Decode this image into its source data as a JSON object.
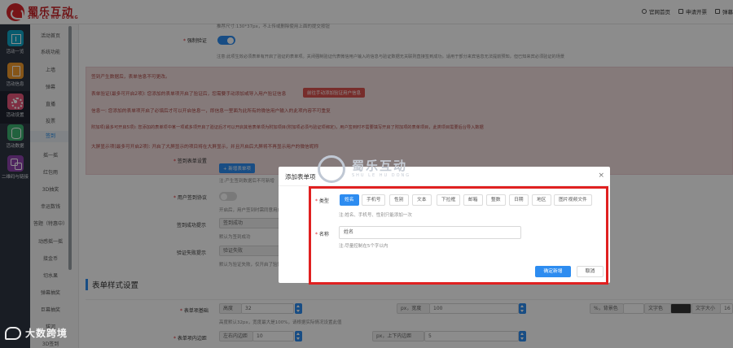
{
  "header": {
    "logo_cn": "蜀乐互动",
    "logo_en": "SHU LE HU DONG",
    "links": [
      "官网首页",
      "申请开票",
      "弹幕"
    ]
  },
  "sidebar": {
    "items": [
      {
        "label": "活动一览",
        "icon": "grid-icon",
        "color": "#0fa7c8"
      },
      {
        "label": "活动信息",
        "icon": "document-icon",
        "color": "#f29b2c"
      },
      {
        "label": "活动设置",
        "icon": "gear-icon",
        "color": "#e8577a"
      },
      {
        "label": "活动数据",
        "icon": "database-icon",
        "color": "#3cb371"
      },
      {
        "label": "二维码与链接",
        "icon": "link-icon",
        "color": "#8e44ad"
      }
    ]
  },
  "submenu": {
    "items": [
      "活动首页",
      "系统功能",
      "上墙",
      "弹幕",
      "直播",
      "投票",
      "签到",
      "摇一摇",
      "红包雨",
      "3D抽奖",
      "幸运数钱",
      "答题（特惠中）",
      "动感摇一摇",
      "接金币",
      "切水果",
      "弹幕抽奖",
      "巨幕抽奖",
      "拔河",
      "3D签到"
    ],
    "active_index": 6
  },
  "main": {
    "top_hint": "推荐尺寸:130*37px，不上传或删除使用上面的提交按钮",
    "force_verify": {
      "label": "强制验证",
      "hint": "注意:此项生效必须表单有开启了验证的表单项。关闭强制验证代表微信用户输入的信息与验证数据无关联则直接签到成功，适用于部分来宾信息无法提前预知，但已知来宾必须验证的场景",
      "on": true
    },
    "notice": {
      "lines": [
        "签到产生数据后，表单信息不可更改。",
        "表单验证(最多可开启2项): 您添加的表单项开启了验证后，您需要手动添加或导入用户验证信息",
        "信息一: 您添加的表单项开启了必填后才可以开启信息一，即信息一里面为此所有的微信用户输入的此项内容不可重复",
        "附加项(最多可开启5项): 您添加的表单项中某一项或多项开启了验证后才可以开启其他表单项为附加项目(附加项必须与验证项绑定)，用户签到时不需要填写开启了附加项的表单项目，此类项目需要后台导入数据",
        "大屏显示项(最多可开启2项): 开启了大屏显示的项目将在大屏显示，并且开启后大屏将不再显示用户的微信昵称"
      ],
      "button": "前往手动添加验证用户信息"
    },
    "signin_form": {
      "label": "签到表单设置",
      "button": "+ 新增表单项",
      "hint": "注:产生签到数据后不可新增"
    },
    "user_protocol": {
      "label": "用户签到协议",
      "hint": "开启后，用户签到时需同意用户协议后才可签到",
      "on": false
    },
    "success_tip": {
      "label": "签到成功提示",
      "value": "签到成功",
      "hint": "默认为签到成功"
    },
    "fail_tip": {
      "label": "验证失败提示",
      "value": "验证失败",
      "hint": "默认为验证失败，仅开启了验证功能时有效"
    },
    "style_section": {
      "title": "表单样式设置",
      "base": {
        "label": "表单项基础",
        "height_prefix": "高度",
        "height_value": "32",
        "height_hint": "高度默认32px，宽度最大是100%，请根据实际情况设置此值",
        "width_prefix": "px，宽度",
        "width_value": "100",
        "bg_prefix": "%，背景色",
        "color_prefix": "文字色",
        "fontsize_prefix": "文字大小",
        "fontsize_value": "16"
      },
      "padding": {
        "label": "表单项内边距",
        "lr_prefix": "左右内边距",
        "lr_value": "10",
        "tb_prefix": "px，上下内边距",
        "tb_value": "5"
      }
    }
  },
  "modal": {
    "title": "添加表单项",
    "close_glyph": "×",
    "watermark_cn": "蜀乐互动",
    "watermark_en": "SHU LE HU DONG",
    "type_label": "类型",
    "types": [
      "姓名",
      "手机号",
      "性别",
      "文本",
      "下拉框",
      "邮箱",
      "整数",
      "日期",
      "地区",
      "图片视频文件"
    ],
    "selected_type": "姓名",
    "type_hint": "注:姓名、手机号、性别只能添加一次",
    "name_label": "名称",
    "name_value": "姓名",
    "name_hint": "注:尽量控制在5个字以内",
    "confirm": "确定新增",
    "cancel": "取消"
  },
  "corner_brand": "大数跨境",
  "colors": {
    "primary": "#2d8cf0",
    "danger": "#d9262b",
    "highlight_frame": "#e02020",
    "notice_bg": "#f2dede",
    "notice_text": "#a94442"
  }
}
